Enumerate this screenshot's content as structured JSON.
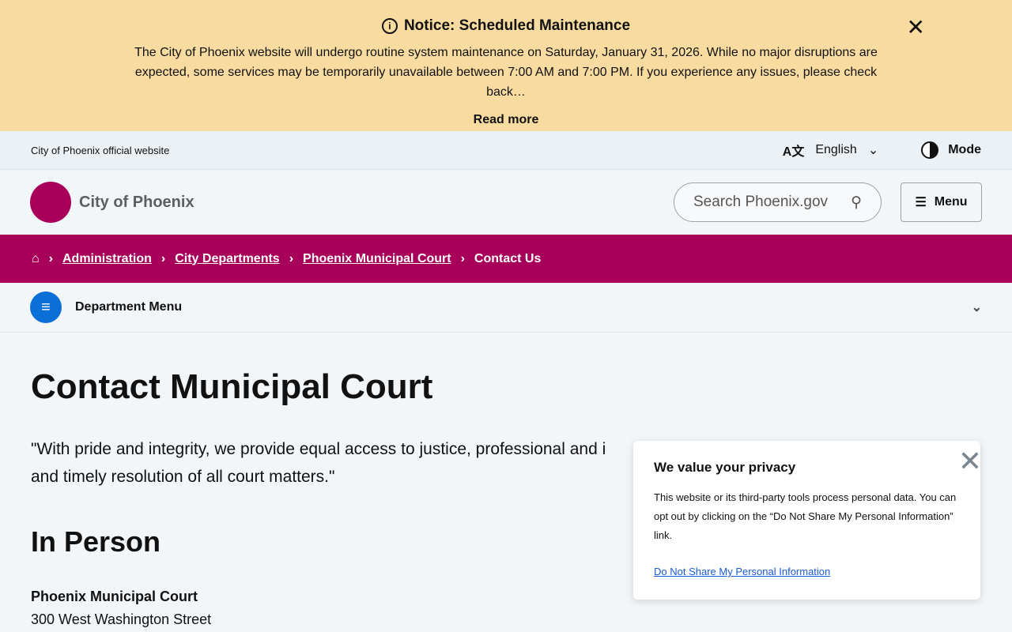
{
  "notice": {
    "title": "Notice: Scheduled Maintenance",
    "body": "The City of Phoenix website will undergo routine system maintenance on Saturday, January 31, 2026. While no major disruptions are expected, some services may be temporarily unavailable between 7:00 AM and 7:00 PM. If you experience any issues, please check back…",
    "read_more": "Read more"
  },
  "utility": {
    "official": "City of Phoenix official website",
    "language": "English",
    "mode": "Mode"
  },
  "header": {
    "brand": "City of Phoenix",
    "search_placeholder": "Search Phoenix.gov",
    "menu": "Menu"
  },
  "breadcrumb": [
    "Administration",
    "City Departments",
    "Phoenix Municipal Court",
    "Contact Us"
  ],
  "dept_menu": "Department Menu",
  "main": {
    "title": "Contact Municipal Court",
    "quote_line1": "\"With pride and integrity, we provide equal access to justice, professional and i",
    "quote_line2": "and timely resolution of all court matters.\"",
    "section": "In Person",
    "addr_name": "Phoenix Municipal Court",
    "addr_street": "300 West Washington Street"
  },
  "privacy": {
    "title": "We value your privacy",
    "body": "This website or its third-party tools process personal data. You can opt out by clicking on the “Do Not Share My Personal Information” link.",
    "link": "Do Not Share My Personal Information"
  }
}
